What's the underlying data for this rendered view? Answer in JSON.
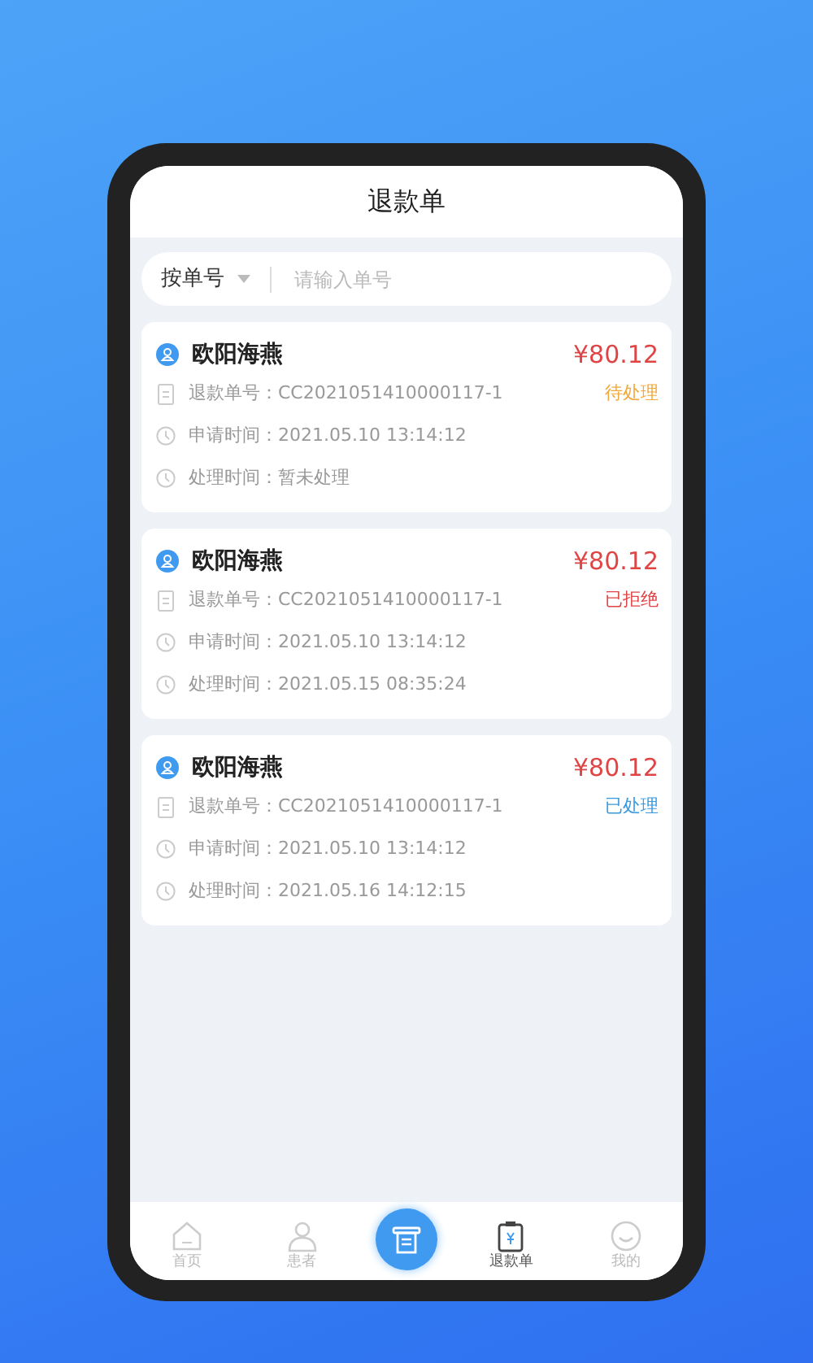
{
  "header": {
    "title": "退款单"
  },
  "search": {
    "filter": "按单号",
    "placeholder": "请输入单号"
  },
  "orders": [
    {
      "name": "欧阳海燕",
      "amount": "¥80.12",
      "number_label": "退款单号：",
      "number": "CC2021051410000117-1",
      "status": "待处理",
      "kind": "pending",
      "apply_label": "申请时间：",
      "apply_time": "2021.05.10 13:14:12",
      "process_label": "处理时间：",
      "process_time": "暂未处理"
    },
    {
      "name": "欧阳海燕",
      "amount": "¥80.12",
      "number_label": "退款单号：",
      "number": "CC2021051410000117-1",
      "status": "已拒绝",
      "kind": "rejected",
      "apply_label": "申请时间：",
      "apply_time": "2021.05.10 13:14:12",
      "process_label": "处理时间：",
      "process_time": "2021.05.15 08:35:24"
    },
    {
      "name": "欧阳海燕",
      "amount": "¥80.12",
      "number_label": "退款单号：",
      "number": "CC2021051410000117-1",
      "status": "已处理",
      "kind": "done",
      "apply_label": "申请时间：",
      "apply_time": "2021.05.10 13:14:12",
      "process_label": "处理时间：",
      "process_time": "2021.05.16 14:12:15"
    }
  ],
  "tabbar": [
    {
      "kind": "home",
      "label": "首页",
      "selected": false
    },
    {
      "kind": "patient",
      "label": "患者",
      "selected": false
    },
    {
      "kind": "center",
      "selected": false
    },
    {
      "kind": "refund",
      "label": "退款单",
      "selected": true
    },
    {
      "kind": "me",
      "label": "我的",
      "selected": false
    }
  ]
}
